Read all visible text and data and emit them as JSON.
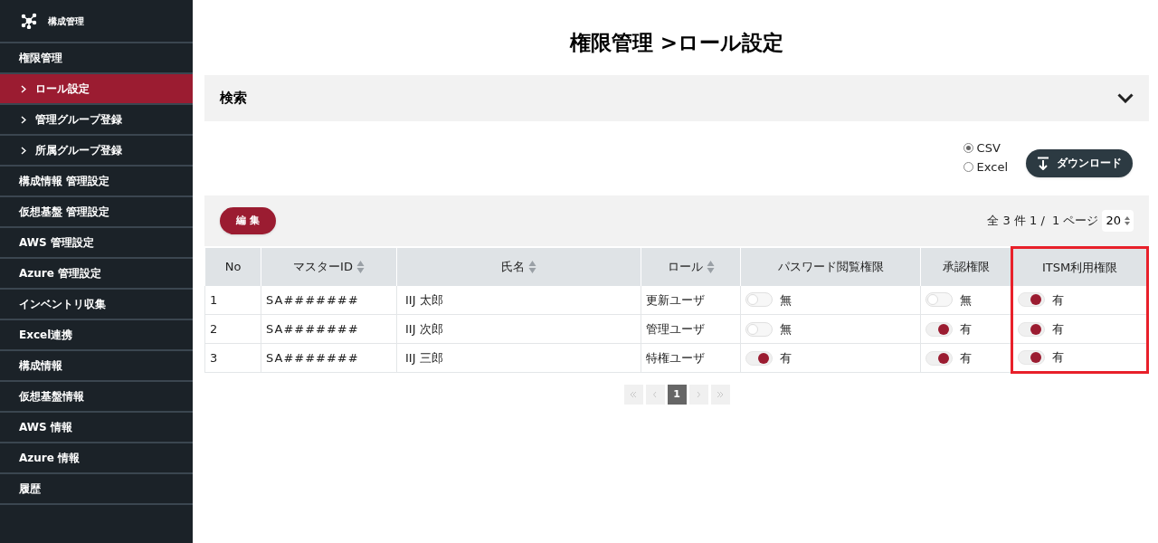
{
  "sidebar": {
    "title": "構成管理",
    "items": [
      {
        "label": "権限管理",
        "kind": "section",
        "selected": false
      },
      {
        "label": "ロール設定",
        "kind": "sub",
        "selected": true
      },
      {
        "label": "管理グループ登録",
        "kind": "sub",
        "selected": false
      },
      {
        "label": "所属グループ登録",
        "kind": "sub",
        "selected": false
      },
      {
        "label": "構成情報 管理設定",
        "kind": "section",
        "selected": false
      },
      {
        "label": "仮想基盤 管理設定",
        "kind": "section",
        "selected": false
      },
      {
        "label": "AWS 管理設定",
        "kind": "section",
        "selected": false
      },
      {
        "label": "Azure 管理設定",
        "kind": "section",
        "selected": false
      },
      {
        "label": "インベントリ収集",
        "kind": "section",
        "selected": false
      },
      {
        "label": "Excel連携",
        "kind": "section",
        "selected": false
      },
      {
        "label": "構成情報",
        "kind": "section",
        "selected": false
      },
      {
        "label": "仮想基盤情報",
        "kind": "section",
        "selected": false
      },
      {
        "label": "AWS 情報",
        "kind": "section",
        "selected": false
      },
      {
        "label": "Azure 情報",
        "kind": "section",
        "selected": false
      },
      {
        "label": "履歴",
        "kind": "section",
        "selected": false
      }
    ]
  },
  "page_title": "権限管理 >ロール設定",
  "search_panel": {
    "title": "検索",
    "expanded": false
  },
  "export": {
    "formats": [
      {
        "label": "CSV",
        "selected": true
      },
      {
        "label": "Excel",
        "selected": false
      }
    ],
    "button": "ダウンロード"
  },
  "toolbar": {
    "edit_button": "編 集",
    "summary": "全 3 件 1 /  1 ページ",
    "page_size": "20"
  },
  "table": {
    "columns": [
      {
        "label": "No",
        "sortable": false,
        "highlighted": false
      },
      {
        "label": "マスターID",
        "sortable": true,
        "highlighted": false
      },
      {
        "label": "氏名",
        "sortable": true,
        "highlighted": false
      },
      {
        "label": "ロール",
        "sortable": true,
        "highlighted": false
      },
      {
        "label": "パスワード閲覧権限",
        "sortable": false,
        "highlighted": false
      },
      {
        "label": "承認権限",
        "sortable": false,
        "highlighted": false
      },
      {
        "label": "ITSM利用権限",
        "sortable": false,
        "highlighted": true
      }
    ],
    "rows": [
      {
        "no": "1",
        "master_id": "SA#######",
        "name": "IIJ 太郎",
        "role": "更新ユーザ",
        "permissions": [
          {
            "on": false,
            "label": "無"
          },
          {
            "on": false,
            "label": "無"
          },
          {
            "on": true,
            "label": "有"
          }
        ]
      },
      {
        "no": "2",
        "master_id": "SA#######",
        "name": "IIJ 次郎",
        "role": "管理ユーザ",
        "permissions": [
          {
            "on": false,
            "label": "無"
          },
          {
            "on": true,
            "label": "有"
          },
          {
            "on": true,
            "label": "有"
          }
        ]
      },
      {
        "no": "3",
        "master_id": "SA#######",
        "name": "IIJ 三郎",
        "role": "特権ユーザ",
        "permissions": [
          {
            "on": true,
            "label": "有"
          },
          {
            "on": true,
            "label": "有"
          },
          {
            "on": true,
            "label": "有"
          }
        ]
      }
    ]
  },
  "pagination": {
    "pages": [
      {
        "label": "1",
        "selected": true
      }
    ]
  }
}
